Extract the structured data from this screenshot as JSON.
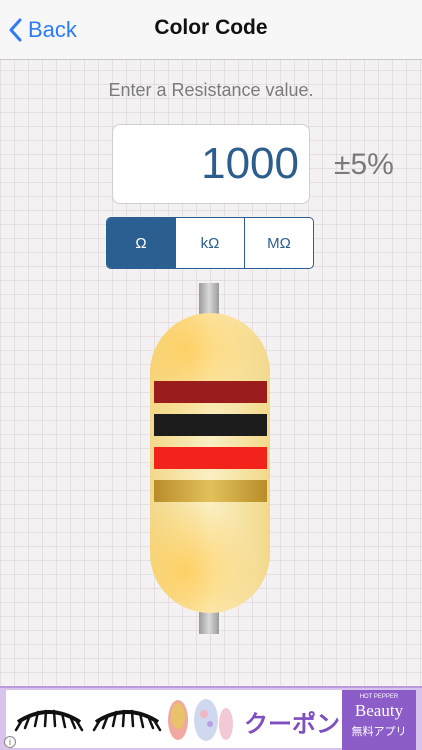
{
  "nav": {
    "back_label": "Back",
    "title": "Color Code"
  },
  "prompt": "Enter a Resistance value.",
  "resistance": {
    "value": "1000",
    "tolerance": "±5%"
  },
  "units": [
    {
      "label": "Ω",
      "selected": true
    },
    {
      "label": "kΩ",
      "selected": false
    },
    {
      "label": "MΩ",
      "selected": false
    }
  ],
  "bands": [
    {
      "name": "brown",
      "color": "#9b1c1c"
    },
    {
      "name": "black",
      "color": "#1c1c1c"
    },
    {
      "name": "red",
      "color": "#f2231b"
    },
    {
      "name": "gold",
      "color": "#c9a33a"
    }
  ],
  "colors": {
    "accent": "#2c5f91",
    "link": "#2d7cf6"
  },
  "ad": {
    "text": "クーポン",
    "brand_small": "HOT PEPPER",
    "brand": "Beauty",
    "sub": "無料アプリ"
  }
}
